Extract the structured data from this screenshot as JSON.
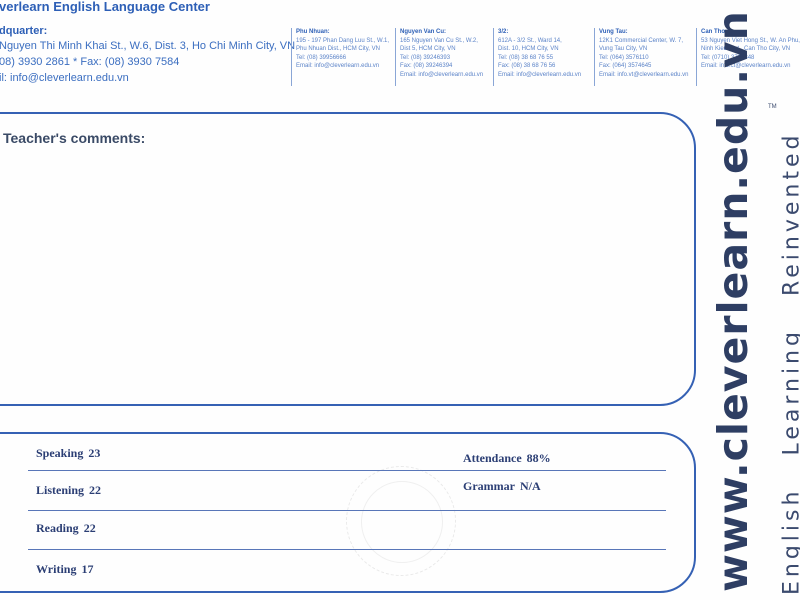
{
  "header": {
    "brand": "verlearn English Language Center",
    "hq_title": "dquarter:",
    "address": "Nguyen Thi Minh Khai St., W.6, Dist. 3, Ho Chi Minh City, VN",
    "phone_fax": "08) 3930 2861 * Fax: (08) 3930 7584",
    "email": "il: info@cleverlearn.edu.vn"
  },
  "branches": [
    {
      "name": "Phu Nhuan:",
      "lines": [
        "195 - 197 Phan Dang Luu St., W.1,",
        "Phu Nhuan Dist., HCM City, VN",
        "Tel: (08) 39956666",
        "Email: info@cleverlearn.edu.vn"
      ]
    },
    {
      "name": "Nguyen Van Cu:",
      "lines": [
        "165 Nguyen Van Cu St., W.2,",
        "Dist 5, HCM City, VN",
        "Tel: (08) 39246393",
        "Fax: (08) 39246394",
        "Email: info@cleverlearn.edu.vn"
      ]
    },
    {
      "name": "3/2:",
      "lines": [
        "612A - 3/2 St., Ward 14,",
        "Dist. 10, HCM City, VN",
        "Tel: (08) 38 68 76 55",
        "Fax: (08) 38 68 76 56",
        "Email: info@cleverlearn.edu.vn"
      ]
    },
    {
      "name": "Vung Tau:",
      "lines": [
        "12K1 Commercial Center, W. 7,",
        "Vung Tau City, VN",
        "Tel: (064) 3576110",
        "Fax: (064) 3574645",
        "Email: info.vt@cleverlearn.edu.vn"
      ]
    },
    {
      "name": "Can Tho:",
      "lines": [
        "53 Nguyen Viet Hong St., W. An Phu,",
        "Ninh Kieu Dist., Can Tho City, VN",
        "Tel: (0710) 3734848",
        "Email: info.ct@cleverlearn.edu.vn"
      ]
    }
  ],
  "comments": {
    "label": "Teacher's comments:"
  },
  "scores": {
    "speaking": {
      "label": "Speaking",
      "value": "23"
    },
    "listening": {
      "label": "Listening",
      "value": "22"
    },
    "reading": {
      "label": "Reading",
      "value": "22"
    },
    "writing": {
      "label": "Writing",
      "value": "17"
    },
    "attendance": {
      "label": "Attendance",
      "value": "88%"
    },
    "grammar": {
      "label": "Grammar",
      "value": "N/A"
    }
  },
  "brand_vertical": {
    "url": "www.cleverlearn.edu.vn",
    "tagline": [
      "English",
      "Learning",
      "Reinvented"
    ],
    "trademark": "TM"
  },
  "colors": {
    "accent": "#3561b4",
    "ink": "#2b3e74",
    "brand_dark": "#2e3e63"
  }
}
